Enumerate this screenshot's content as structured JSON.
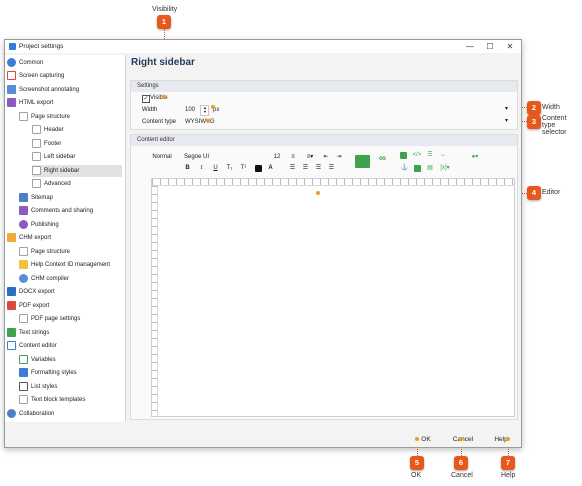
{
  "annotations": [
    {
      "number": "1",
      "label": "Visibility"
    },
    {
      "number": "2",
      "label": "Width"
    },
    {
      "number": "3",
      "label": "Content type selector"
    },
    {
      "number": "4",
      "label": "Editor"
    },
    {
      "number": "5",
      "label": "OK"
    },
    {
      "number": "6",
      "label": "Cancel"
    },
    {
      "number": "7",
      "label": "Help"
    }
  ],
  "window": {
    "title": "Project settings",
    "controls": {
      "minimize": "—",
      "maximize": "☐",
      "close": "✕"
    }
  },
  "sidebar": {
    "items": [
      {
        "label": "Common",
        "icon": "gear-icon",
        "color": "#3b7dd8"
      },
      {
        "label": "Screen capturing",
        "icon": "screen-capture-icon",
        "color": "#d94a3d"
      },
      {
        "label": "Screenshot annotating",
        "icon": "annotate-icon",
        "color": "#5b8dd6"
      },
      {
        "label": "HTML export",
        "icon": "html-export-icon",
        "color": "#8a5ac2"
      },
      {
        "label": "Page structure",
        "icon": "page-structure-icon",
        "color": "#9aa3ad"
      },
      {
        "label": "Header",
        "icon": "header-icon",
        "color": "#9aa3ad"
      },
      {
        "label": "Footer",
        "icon": "footer-icon",
        "color": "#9aa3ad"
      },
      {
        "label": "Left sidebar",
        "icon": "left-sidebar-icon",
        "color": "#9aa3ad"
      },
      {
        "label": "Right sidebar",
        "icon": "right-sidebar-icon",
        "color": "#9aa3ad"
      },
      {
        "label": "Advanced",
        "icon": "advanced-icon",
        "color": "#9aa3ad"
      },
      {
        "label": "Sitemap",
        "icon": "sitemap-icon",
        "color": "#4a7fc9"
      },
      {
        "label": "Comments and sharing",
        "icon": "comments-icon",
        "color": "#8a5ac2"
      },
      {
        "label": "Publishing",
        "icon": "publishing-icon",
        "color": "#8a5ac2"
      },
      {
        "label": "CHM export",
        "icon": "chm-export-icon",
        "color": "#f2a93b"
      },
      {
        "label": "Page structure",
        "icon": "page-structure-icon",
        "color": "#9aa3ad"
      },
      {
        "label": "Help Context ID management",
        "icon": "context-id-icon",
        "color": "#f2c23b"
      },
      {
        "label": "CHM compiler",
        "icon": "compiler-icon",
        "color": "#5b8dd6"
      },
      {
        "label": "DOCX export",
        "icon": "docx-export-icon",
        "color": "#2b6cc4"
      },
      {
        "label": "PDF export",
        "icon": "pdf-export-icon",
        "color": "#d94a3d"
      },
      {
        "label": "PDF page settings",
        "icon": "pdf-page-settings-icon",
        "color": "#9aa3ad"
      },
      {
        "label": "Text strings",
        "icon": "text-strings-icon",
        "color": "#3fa34d"
      },
      {
        "label": "Content editor",
        "icon": "content-editor-icon",
        "color": "#3b7dd8"
      },
      {
        "label": "Variables",
        "icon": "variables-icon",
        "color": "#3fa34d"
      },
      {
        "label": "Formatting styles",
        "icon": "formatting-styles-icon",
        "color": "#3b7dd8"
      },
      {
        "label": "List styles",
        "icon": "list-styles-icon",
        "color": "#555555"
      },
      {
        "label": "Text block templates",
        "icon": "text-block-icon",
        "color": "#9aa3ad"
      },
      {
        "label": "Collaboration",
        "icon": "collaboration-icon",
        "color": "#4a7fc9"
      }
    ],
    "selected_index": 8
  },
  "main": {
    "title": "Right sidebar",
    "settings_group": {
      "header": "Settings",
      "visible_label": "Visible",
      "visible_checked": true,
      "width_label": "Width",
      "width_value": "100",
      "width_unit": "px",
      "content_type_label": "Content type",
      "content_type_value": "WYSIWYG"
    },
    "editor_group": {
      "header": "Content editor",
      "style_value": "Normal",
      "font_value": "Segoe UI",
      "size_value": "12"
    }
  },
  "footer_buttons": {
    "ok": "OK",
    "cancel": "Cancel",
    "help": "Help"
  },
  "colors": {
    "accent": "#e8571c",
    "title": "#1f3a5c",
    "group_header": "#e6e9ef"
  }
}
